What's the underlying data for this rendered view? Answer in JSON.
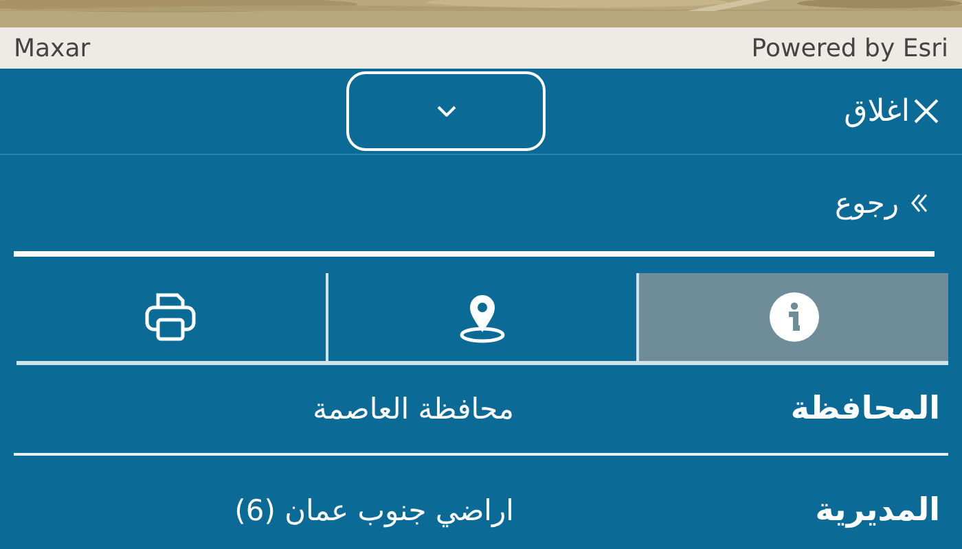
{
  "map": {
    "attribution_left": "Maxar",
    "attribution_right": "Powered by Esri"
  },
  "panel": {
    "close_label": "اغلاق",
    "back_label": "رجوع"
  },
  "tabs": [
    {
      "kind": "info",
      "selected": true
    },
    {
      "kind": "location",
      "selected": false
    },
    {
      "kind": "print",
      "selected": false
    }
  ],
  "rows": [
    {
      "label": "المحافظة",
      "value": "محافظة العاصمة"
    },
    {
      "label": "المديرية",
      "value": "اراضي جنوب عمان (6)"
    }
  ]
}
